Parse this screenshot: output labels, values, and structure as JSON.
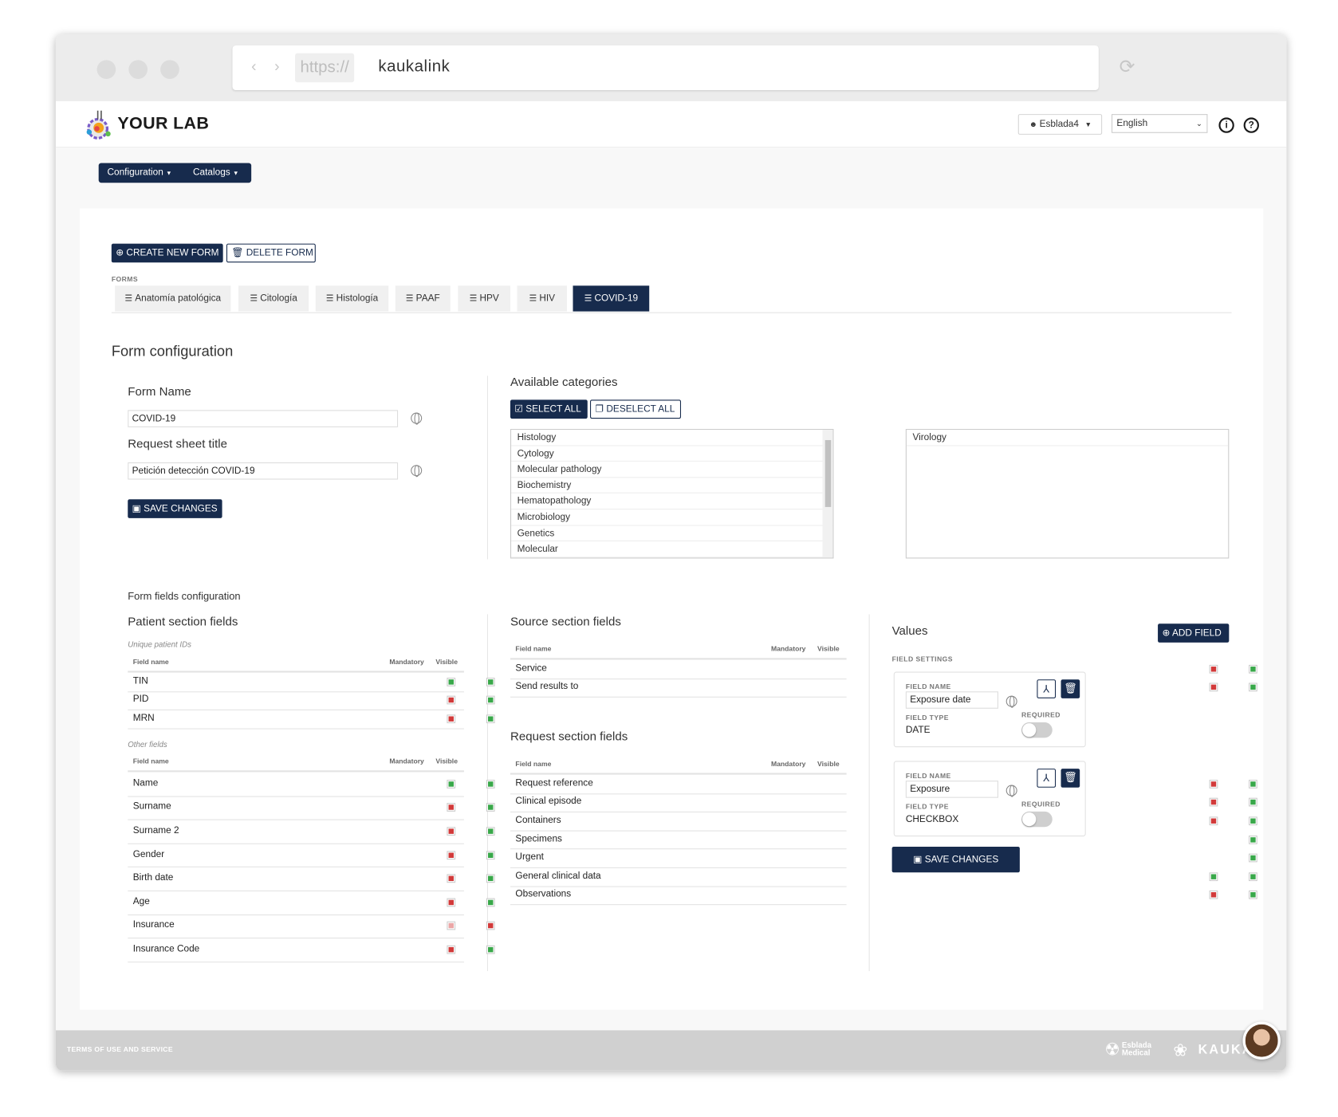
{
  "browser": {
    "protocol": "https://",
    "url": "kaukalink"
  },
  "header": {
    "brand": "YOUR LAB",
    "user": "Esblada4",
    "language": "English"
  },
  "menu": {
    "configuration": "Configuration",
    "catalogs": "Catalogs"
  },
  "actions": {
    "create_form": "CREATE NEW FORM",
    "delete_form": "DELETE FORM"
  },
  "forms": {
    "label": "FORMS",
    "tabs": [
      "Anatomía patológica",
      "Citología",
      "Histología",
      "PAAF",
      "HPV",
      "HIV",
      "COVID-19"
    ],
    "active": "COVID-19"
  },
  "form_config": {
    "title": "Form configuration",
    "form_name_label": "Form Name",
    "form_name_value": "COVID-19",
    "request_title_label": "Request sheet title",
    "request_title_value": "Petición detección COVID-19",
    "save_label": "SAVE CHANGES"
  },
  "categories": {
    "title": "Available categories",
    "select_all": "SELECT ALL",
    "deselect_all": "DESELECT ALL",
    "available": [
      "Histology",
      "Cytology",
      "Molecular pathology",
      "Biochemistry",
      "Hematopathology",
      "Microbiology",
      "Genetics",
      "Molecular"
    ],
    "selected": [
      "Virology"
    ]
  },
  "fields_config": {
    "title": "Form fields configuration",
    "col_field_name": "Field name",
    "col_mandatory": "Mandatory",
    "col_visible": "Visible",
    "patient": {
      "title": "Patient section fields",
      "unique_label": "Unique patient IDs",
      "unique_rows": [
        {
          "name": "TIN",
          "mandatory": "on",
          "visible": "on"
        },
        {
          "name": "PID",
          "mandatory": "off",
          "visible": "on"
        },
        {
          "name": "MRN",
          "mandatory": "off",
          "visible": "on"
        }
      ],
      "other_label": "Other fields",
      "other_rows": [
        {
          "name": "Name",
          "mandatory": "on",
          "visible": "on"
        },
        {
          "name": "Surname",
          "mandatory": "off",
          "visible": "on"
        },
        {
          "name": "Surname 2",
          "mandatory": "off",
          "visible": "on"
        },
        {
          "name": "Gender",
          "mandatory": "off",
          "visible": "on"
        },
        {
          "name": "Birth date",
          "mandatory": "off",
          "visible": "on"
        },
        {
          "name": "Age",
          "mandatory": "off",
          "visible": "on"
        },
        {
          "name": "Insurance",
          "mandatory": "disabled",
          "visible": "off"
        },
        {
          "name": "Insurance Code",
          "mandatory": "off",
          "visible": "on"
        }
      ]
    },
    "source": {
      "title": "Source section fields",
      "rows": [
        {
          "name": "Service",
          "mandatory": "off",
          "visible": "on"
        },
        {
          "name": "Send results to",
          "mandatory": "off",
          "visible": "on"
        }
      ]
    },
    "request": {
      "title": "Request section fields",
      "rows": [
        {
          "name": "Request reference",
          "mandatory": "off",
          "visible": "on"
        },
        {
          "name": "Clinical episode",
          "mandatory": "off",
          "visible": "on"
        },
        {
          "name": "Containers",
          "mandatory": "off",
          "visible": "on"
        },
        {
          "name": "Specimens",
          "mandatory": "none",
          "visible": "on"
        },
        {
          "name": "Urgent",
          "mandatory": "none",
          "visible": "on"
        },
        {
          "name": "General clinical data",
          "mandatory": "on",
          "visible": "on"
        },
        {
          "name": "Observations",
          "mandatory": "off",
          "visible": "on"
        }
      ]
    }
  },
  "values": {
    "title": "Values",
    "add_field": "ADD FIELD",
    "settings_label": "FIELD SETTINGS",
    "field_name_label": "FIELD NAME",
    "field_type_label": "FIELD TYPE",
    "required_label": "REQUIRED",
    "fields": [
      {
        "name": "Exposure date",
        "type": "DATE",
        "required": false
      },
      {
        "name": "Exposure",
        "type": "CHECKBOX",
        "required": false
      }
    ],
    "save_label": "SAVE CHANGES"
  },
  "footer": {
    "terms": "TERMS OF USE AND SERVICE",
    "partner_line1": "Esblada",
    "partner_line2": "Medical",
    "brand": "KAUKA"
  },
  "colors": {
    "primary": "#172b4d",
    "on": "#39a84a",
    "off": "#d23a3a"
  }
}
